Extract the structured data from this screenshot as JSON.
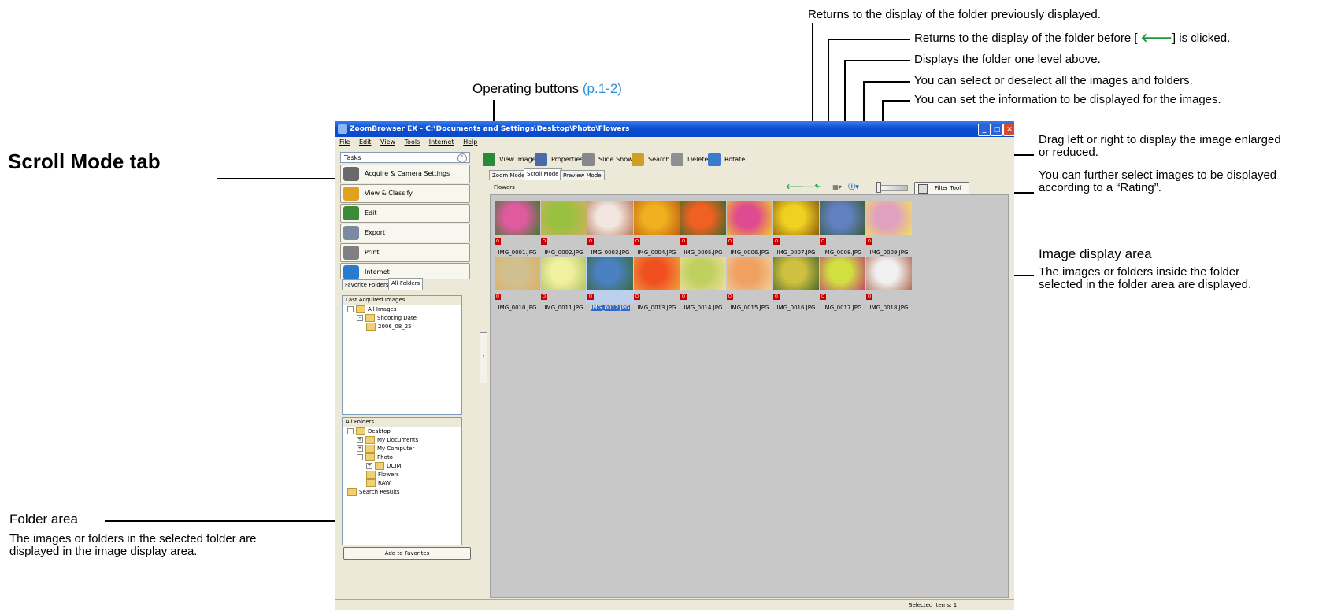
{
  "annotations": {
    "nav_back": "Returns to the display of the folder previously displayed.",
    "nav_forward_prefix": "Returns to the display of the folder before [",
    "nav_forward_suffix": "] is clicked.",
    "nav_up": "Displays the folder one level above.",
    "select_all": "You can select or deselect all the images and folders.",
    "info_set": "You can set the information to be displayed for the images.",
    "operating_buttons": "Operating buttons",
    "operating_buttons_ref": "(p.1-2)",
    "scroll_mode_tab": "Scroll Mode tab",
    "slider_line1": "Drag left or right to display the image enlarged",
    "slider_line2": "or reduced.",
    "filter_line1": "You can further select images to be displayed",
    "filter_line2": "according to a “Rating”.",
    "image_area_title": "Image display area",
    "image_area_line1": "The images or folders inside the folder",
    "image_area_line2": "selected in the folder area are displayed.",
    "folder_area_title": "Folder area",
    "folder_area_line1": "The images or folders in the selected folder are",
    "folder_area_line2": "displayed in the image display area."
  },
  "window": {
    "title": "ZoomBrowser EX  -  C:\\Documents and Settings\\Desktop\\Photo\\Flowers",
    "menu": [
      "File",
      "Edit",
      "View",
      "Tools",
      "Internet",
      "Help"
    ]
  },
  "tasks": {
    "label": "Tasks",
    "buttons": [
      {
        "label": "Acquire & Camera Settings",
        "color": "#6a6a6a"
      },
      {
        "label": "View & Classify",
        "color": "#e0a020"
      },
      {
        "label": "Edit",
        "color": "#3a8a3a"
      },
      {
        "label": "Export",
        "color": "#7a8aa0"
      },
      {
        "label": "Print",
        "color": "#808080"
      },
      {
        "label": "Internet",
        "color": "#2a7ad0"
      }
    ]
  },
  "toolbar": {
    "buttons": [
      {
        "label": "View Image",
        "color": "#2a8a3a"
      },
      {
        "label": "Properties",
        "color": "#4a6aaa"
      },
      {
        "label": "Slide Show",
        "color": "#888888"
      },
      {
        "label": "Search",
        "color": "#d0a020"
      },
      {
        "label": "Delete",
        "color": "#909090"
      },
      {
        "label": "Rotate",
        "color": "#3a7ad0"
      }
    ]
  },
  "folder_panel": {
    "tab_favorites": "Favorite Folders",
    "tab_all": "All Folders",
    "last_acquired_header": "Last Acquired Images",
    "last_acquired_tree": [
      "All Images",
      "Shooting Date",
      "2006_08_25"
    ],
    "all_folders_header": "All Folders",
    "all_folders_tree": [
      "Desktop",
      "My Documents",
      "My Computer",
      "Photo",
      "DCIM",
      "Flowers",
      "RAW",
      "Search Results"
    ],
    "add_favorites": "Add to Favorites"
  },
  "view": {
    "tab_zoom": "Zoom Mode",
    "tab_scroll": "Scroll Mode",
    "tab_preview": "Preview Mode",
    "folder_name": "Flowers",
    "filter_tool": "Filter Tool",
    "nav_icons": [
      "back-arrow",
      "forward-arrow",
      "up-arrow",
      "select-all",
      "info"
    ]
  },
  "thumbnails": [
    {
      "name": "IMG_0001.JPG",
      "c1": "#e05aa0",
      "c2": "#3a7a2a"
    },
    {
      "name": "IMG_0002.JPG",
      "c1": "#9ac040",
      "c2": "#d0b060"
    },
    {
      "name": "IMG_0003.JPG",
      "c1": "#f2e6e0",
      "c2": "#b87a5a"
    },
    {
      "name": "IMG_0004.JPG",
      "c1": "#f0b020",
      "c2": "#c06010"
    },
    {
      "name": "IMG_0005.JPG",
      "c1": "#f06020",
      "c2": "#3a6a2a"
    },
    {
      "name": "IMG_0006.JPG",
      "c1": "#e04a90",
      "c2": "#f0d020"
    },
    {
      "name": "IMG_0007.JPG",
      "c1": "#f0d020",
      "c2": "#8a5a10"
    },
    {
      "name": "IMG_0008.JPG",
      "c1": "#6080c0",
      "c2": "#3a5a3a"
    },
    {
      "name": "IMG_0009.JPG",
      "c1": "#e0a0c0",
      "c2": "#f0e060"
    },
    {
      "name": "IMG_0010.JPG",
      "c1": "#d0c090",
      "c2": "#e0b060"
    },
    {
      "name": "IMG_0011.JPG",
      "c1": "#f0f0a0",
      "c2": "#b0c060"
    },
    {
      "name": "IMG_0012.JPG",
      "c1": "#4a80c0",
      "c2": "#3a6a3a",
      "selected": true
    },
    {
      "name": "IMG_0013.JPG",
      "c1": "#f05020",
      "c2": "#f0a040"
    },
    {
      "name": "IMG_0014.JPG",
      "c1": "#c0d060",
      "c2": "#f0e0a0"
    },
    {
      "name": "IMG_0015.JPG",
      "c1": "#f0a060",
      "c2": "#f0d0a0"
    },
    {
      "name": "IMG_0016.JPG",
      "c1": "#d0c040",
      "c2": "#4a6a2a"
    },
    {
      "name": "IMG_0017.JPG",
      "c1": "#d0e040",
      "c2": "#c04070"
    },
    {
      "name": "IMG_0018.JPG",
      "c1": "#f0f0f0",
      "c2": "#b06a50"
    }
  ],
  "status": {
    "selected": "Selected Items: 1"
  }
}
